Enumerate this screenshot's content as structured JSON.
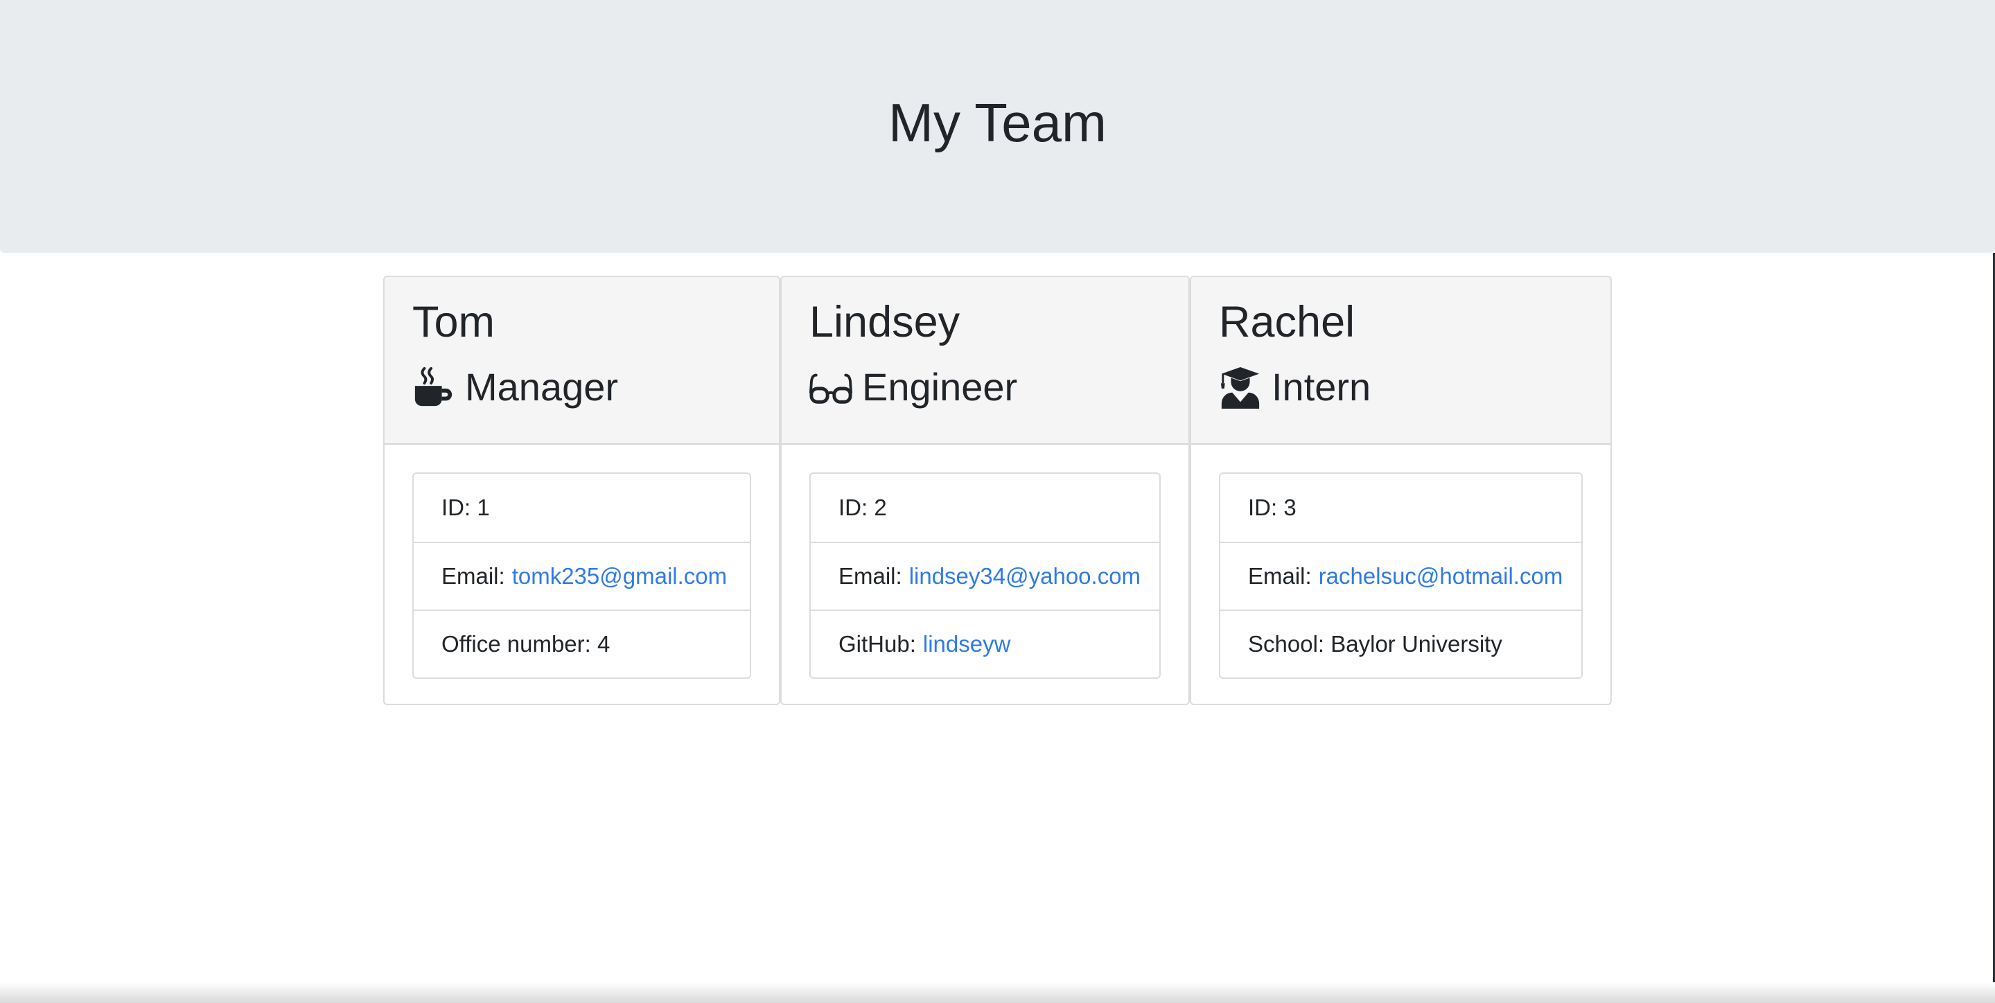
{
  "header": {
    "title": "My Team"
  },
  "team": [
    {
      "name": "Tom",
      "role": "Manager",
      "icon": "mug-hot-icon",
      "id_label": "ID:",
      "id_value": "1",
      "email_label": "Email:",
      "email_value": "tomk235@gmail.com",
      "extra_label": "Office number:",
      "extra_value": "4"
    },
    {
      "name": "Lindsey",
      "role": "Engineer",
      "icon": "glasses-icon",
      "id_label": "ID:",
      "id_value": "2",
      "email_label": "Email:",
      "email_value": "lindsey34@yahoo.com",
      "extra_label": "GitHub:",
      "extra_value": "lindseyw"
    },
    {
      "name": "Rachel",
      "role": "Intern",
      "icon": "user-graduate-icon",
      "id_label": "ID:",
      "id_value": "3",
      "email_label": "Email:",
      "email_value": "rachelsuc@hotmail.com",
      "extra_label": "School:",
      "extra_value": "Baylor University"
    }
  ],
  "colors": {
    "jumbotron_bg": "#e9ecef",
    "card_header_bg": "#f5f5f5",
    "link": "#2f7be5",
    "text": "#212529"
  }
}
